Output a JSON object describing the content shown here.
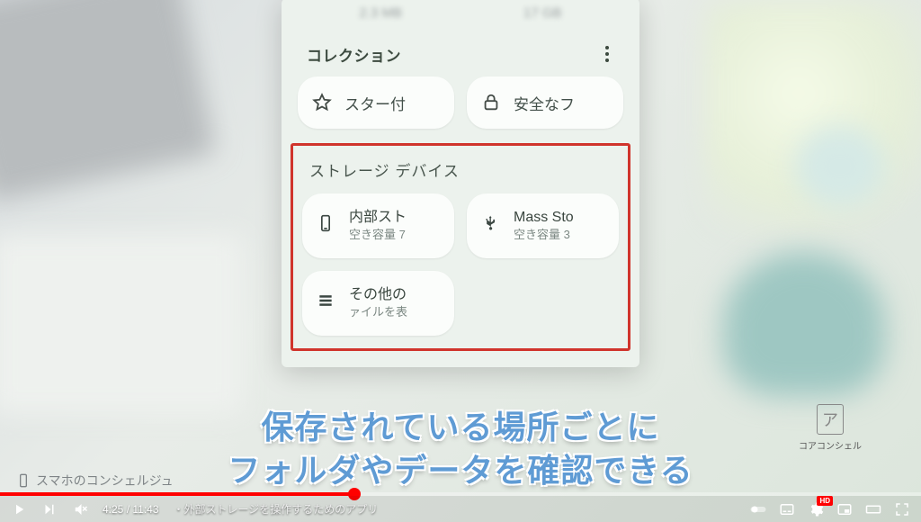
{
  "phone": {
    "top_values": [
      "2.3 MB",
      "17 GB"
    ],
    "collection_label": "コレクション",
    "chips": [
      {
        "icon": "star-outline-icon",
        "label": "スター付"
      },
      {
        "icon": "lock-icon",
        "label": "安全なフ"
      }
    ],
    "storage_section_label": "ストレージ デバイス",
    "cards": [
      {
        "icon": "phone-icon",
        "title": "内部スト",
        "subtitle": "空き容量 7"
      },
      {
        "icon": "usb-icon",
        "title": "Mass Sto",
        "subtitle": "空き容量 3"
      },
      {
        "icon": "list-icon",
        "title": "その他の",
        "subtitle": "ァイルを表"
      }
    ]
  },
  "caption": {
    "line1": "保存されている場所ごとに",
    "line2": "フォルダやデータを確認できる"
  },
  "watermark": "スマホのコンシェルジュ",
  "side_logo_label": "コアコンシェル",
  "player": {
    "current": "4:25",
    "total": "11:43",
    "chapter": "・外部ストレージを操作するためのアプリ",
    "hd_badge": "HD",
    "progress_percent": 38.5
  }
}
